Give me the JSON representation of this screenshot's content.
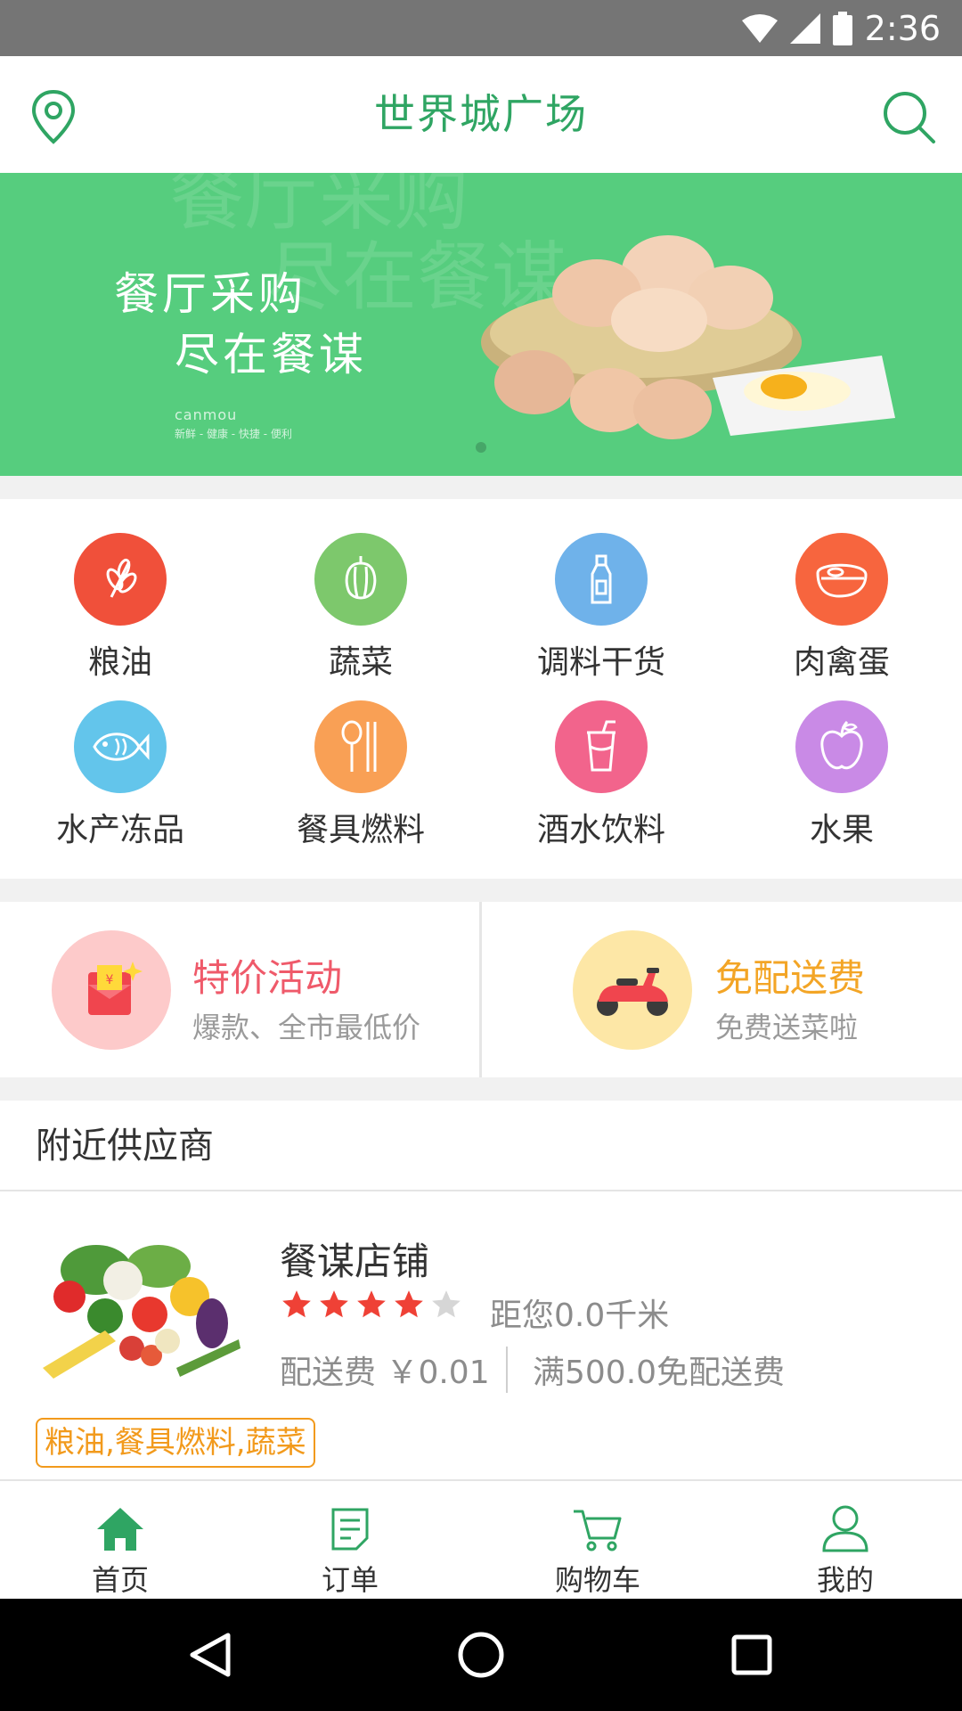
{
  "status_bar": {
    "time": "2:36"
  },
  "app_bar": {
    "title": "世界城广场"
  },
  "banner": {
    "line1": "餐厅采购",
    "line2": "尽在餐谋",
    "brand": "canmou",
    "slogan": "新鲜 - 健康 - 快捷 - 便利",
    "ghost1": "餐厅采购",
    "ghost2": "尽在餐谋"
  },
  "categories": [
    {
      "label": "粮油",
      "color": "#f0503a",
      "icon": "grain-icon"
    },
    {
      "label": "蔬菜",
      "color": "#7dc86c",
      "icon": "pepper-icon"
    },
    {
      "label": "调料干货",
      "color": "#6fb2ea",
      "icon": "bottle-icon"
    },
    {
      "label": "肉禽蛋",
      "color": "#f7653e",
      "icon": "meat-icon"
    },
    {
      "label": "水产冻品",
      "color": "#63c5eb",
      "icon": "fish-icon"
    },
    {
      "label": "餐具燃料",
      "color": "#f9a055",
      "icon": "cutlery-icon"
    },
    {
      "label": "酒水饮料",
      "color": "#f2648c",
      "icon": "drink-icon"
    },
    {
      "label": "水果",
      "color": "#c98ae6",
      "icon": "apple-icon"
    }
  ],
  "promos": [
    {
      "title": "特价活动",
      "subtitle": "爆款、全市最低价",
      "title_color": "#ef5a6a",
      "circle_color": "#fdcaca"
    },
    {
      "title": "免配送费",
      "subtitle": "免费送菜啦",
      "title_color": "#f3a526",
      "circle_color": "#fde7a6"
    }
  ],
  "nearby": {
    "heading": "附近供应商",
    "store": {
      "name": "餐谋店铺",
      "rating": 4,
      "rating_max": 5,
      "distance": "距您0.0千米",
      "fee": "配送费 ￥0.01",
      "free_threshold": "满500.0免配送费",
      "tags": "粮油,餐具燃料,蔬菜"
    }
  },
  "tabs": [
    {
      "label": "首页",
      "icon": "home-icon",
      "active": true
    },
    {
      "label": "订单",
      "icon": "order-icon",
      "active": false
    },
    {
      "label": "购物车",
      "icon": "cart-icon",
      "active": false
    },
    {
      "label": "我的",
      "icon": "user-icon",
      "active": false
    }
  ],
  "colors": {
    "accent": "#2fa563",
    "banner": "#56cd7e",
    "tag": "#f29a1c",
    "star": "#ef4136"
  }
}
